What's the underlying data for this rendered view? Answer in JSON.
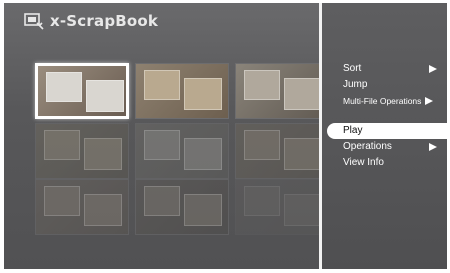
{
  "app": {
    "title": "x-ScrapBook",
    "icon": "scrapbook-camera-icon"
  },
  "thumbnails": [
    {
      "id": "t1",
      "state": "selected",
      "colors": [
        "#9a8d7e",
        "#d9d6d0",
        "#6a5d52"
      ]
    },
    {
      "id": "t2",
      "state": "normal",
      "colors": [
        "#8e8170",
        "#b9a98f",
        "#6d5f4f"
      ]
    },
    {
      "id": "t3",
      "state": "normal",
      "colors": [
        "#8a847a",
        "#b0a89c",
        "#615a52"
      ]
    },
    {
      "id": "t4",
      "state": "dim",
      "colors": [
        "#6e6a60",
        "#8c8576",
        "#5a5750"
      ]
    },
    {
      "id": "t5",
      "state": "dim",
      "colors": [
        "#6c6b67",
        "#8b8a86",
        "#5d5d5b"
      ]
    },
    {
      "id": "t6",
      "state": "dim",
      "colors": [
        "#6b665d",
        "#857d70",
        "#5b5751"
      ]
    },
    {
      "id": "t7",
      "state": "dim",
      "colors": [
        "#6a6560",
        "#807970",
        "#5b5752"
      ]
    },
    {
      "id": "t8",
      "state": "dim",
      "colors": [
        "#5e5b58",
        "#7a746c",
        "#4f4d4b"
      ]
    },
    {
      "id": "t9",
      "state": "faded",
      "colors": [
        "#6a6866",
        "#807d78",
        "#5f5e5c"
      ]
    }
  ],
  "menu": {
    "items": [
      {
        "label": "Sort",
        "has_submenu": true
      },
      {
        "label": "Jump",
        "has_submenu": false
      },
      {
        "label": "Multi-File Operations",
        "has_submenu": true
      },
      {
        "label": "Play",
        "has_submenu": false,
        "highlighted": true
      },
      {
        "label": "Operations",
        "has_submenu": true
      },
      {
        "label": "View Info",
        "has_submenu": false
      }
    ]
  },
  "colors": {
    "screen_bg": "#5b5b5d",
    "highlight": "#ffffff",
    "menu_text": "#ffffff"
  }
}
